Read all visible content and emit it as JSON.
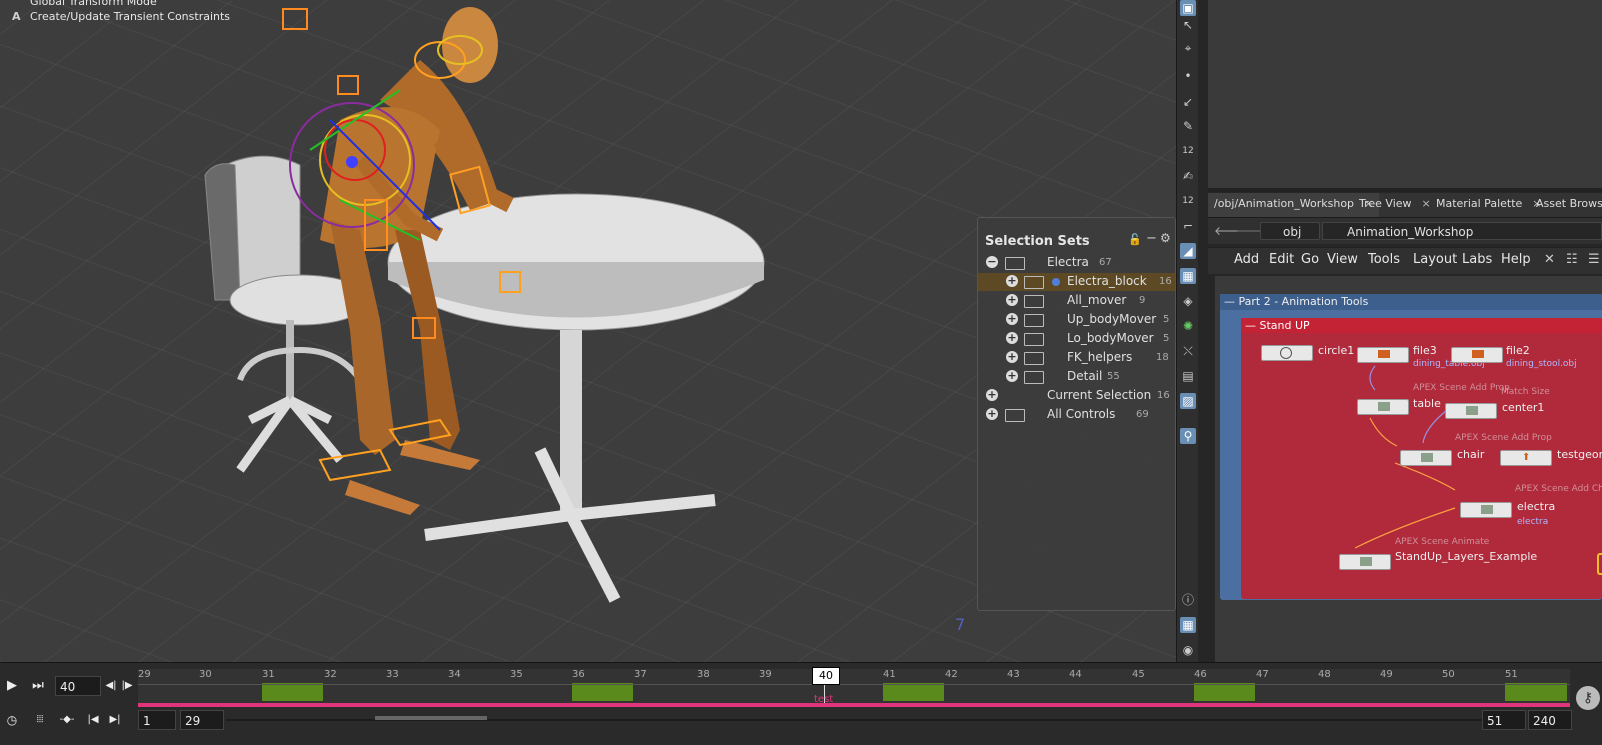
{
  "viewport": {
    "messages": [
      {
        "key": "",
        "text": "Global Transform Mode"
      },
      {
        "key": "A",
        "text": "Create/Update Transient Constraints"
      }
    ]
  },
  "selection_sets": {
    "title": "Selection Sets",
    "items": [
      {
        "label": "Electra",
        "count": "67"
      },
      {
        "label": "Electra_block",
        "count": "16"
      },
      {
        "label": "All_mover",
        "count": "9"
      },
      {
        "label": "Up_bodyMover",
        "count": "5"
      },
      {
        "label": "Lo_bodyMover",
        "count": "5"
      },
      {
        "label": "FK_helpers",
        "count": "18"
      },
      {
        "label": "Detail",
        "count": "55"
      },
      {
        "label": "Current Selection",
        "count": "16"
      },
      {
        "label": "All Controls",
        "count": "69"
      }
    ]
  },
  "tabs": [
    {
      "label": "/obj/Animation_Workshop"
    },
    {
      "label": "Tree View"
    },
    {
      "label": "Material Palette"
    },
    {
      "label": "Asset Browser"
    }
  ],
  "path": {
    "root": "obj",
    "current": "Animation_Workshop"
  },
  "menu": [
    "Add",
    "Edit",
    "Go",
    "View",
    "Tools",
    "Layout",
    "Labs",
    "Help"
  ],
  "network": {
    "box1": "Part 2 - Animation Tools",
    "box2": "Stand UP",
    "nodes": [
      {
        "name": "circle1",
        "sub": "",
        "file": ""
      },
      {
        "name": "file3",
        "sub": "",
        "file": "dining_table.obj"
      },
      {
        "name": "file2",
        "sub": "",
        "file": "dining_stool.obj"
      },
      {
        "name": "table",
        "sub": "APEX Scene Add Prop",
        "file": ""
      },
      {
        "name": "center1",
        "sub": "Match Size",
        "file": ""
      },
      {
        "name": "chair",
        "sub": "APEX Scene Add Prop",
        "file": ""
      },
      {
        "name": "testgeom",
        "sub": "",
        "file": ""
      },
      {
        "name": "electra",
        "sub": "APEX Scene Add Character",
        "file": "electra"
      },
      {
        "name": "StandUp_Layers_Example",
        "sub": "APEX Scene Animate",
        "file": ""
      }
    ]
  },
  "timeline": {
    "current_frame": "40",
    "start": "1",
    "range_start": "29",
    "range_end": "51",
    "end": "240",
    "ticks": [
      "29",
      "30",
      "31",
      "32",
      "33",
      "34",
      "35",
      "36",
      "37",
      "38",
      "39",
      "40",
      "41",
      "42",
      "43",
      "44",
      "45",
      "46",
      "47",
      "48",
      "49",
      "50",
      "51"
    ],
    "marker_label": "40",
    "marker_text": "test"
  }
}
